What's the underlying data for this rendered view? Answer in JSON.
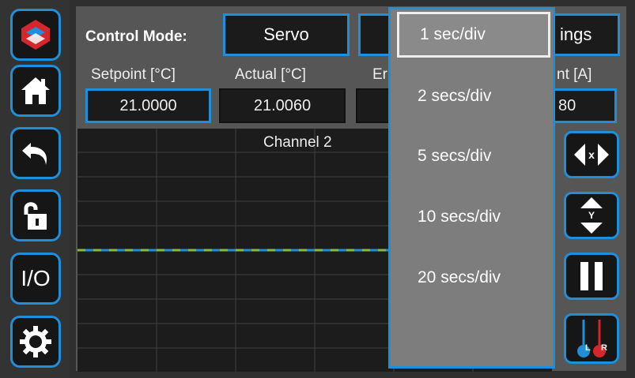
{
  "header": {
    "mode_label": "Control Mode:",
    "mode_value": "Servo",
    "middle_button": "",
    "settings_partial": "ings"
  },
  "fields": {
    "setpoint_label": "Setpoint [°C]",
    "setpoint_value": "21.0000",
    "actual_label": "Actual [°C]",
    "actual_value": "21.0060",
    "error_label_partial": "Er",
    "current_label_partial": "nt [A]",
    "current_value_partial": "80"
  },
  "plot": {
    "title": "Channel 2"
  },
  "side_buttons": {
    "io_label": "I/O"
  },
  "right_buttons": {
    "x_label": "x",
    "y_label": "Y",
    "left_label": "L",
    "right_label": "R"
  },
  "dropdown": {
    "options": [
      "1 sec/div",
      "2 secs/div",
      "5 secs/div",
      "10 secs/div",
      "20 secs/div"
    ],
    "selected_index": 0
  },
  "colors": {
    "accent": "#1e8fd8",
    "trace_green": "#8ab840",
    "trace_blue": "#1e8fd8"
  }
}
